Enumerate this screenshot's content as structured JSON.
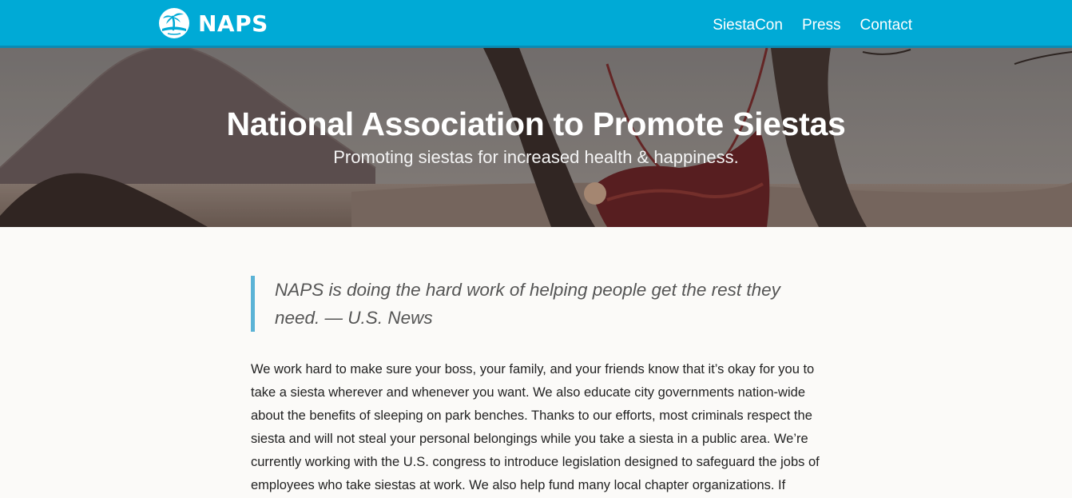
{
  "header": {
    "brand": "NAPS",
    "logo_icon": "palm-tree-island-icon",
    "nav": [
      {
        "label": "SiestaCon"
      },
      {
        "label": "Press"
      },
      {
        "label": "Contact"
      }
    ],
    "colors": {
      "bar": "#00aad6",
      "bar_border": "#0a8ab3"
    }
  },
  "hero": {
    "title": "National Association to Promote Siestas",
    "subtitle": "Promoting siestas for increased health & happiness."
  },
  "quote": {
    "text": "NAPS is doing the hard work of helping people get the rest they need. — U.S. News",
    "accent": "#5bb3d6"
  },
  "body": {
    "paragraph": "We work hard to make sure your boss, your family, and your friends know that it’s okay for you to take a siesta wherever and whenever you want. We also educate city governments nation-wide about the benefits of sleeping on park benches. Thanks to our efforts, most criminals respect the siesta and will not steal your personal belongings while you take a siesta in a public area. We’re currently working with the U.S. congress to introduce legislation designed to safeguard the jobs of employees who take siestas at work. We also help fund many local chapter organizations. If"
  }
}
